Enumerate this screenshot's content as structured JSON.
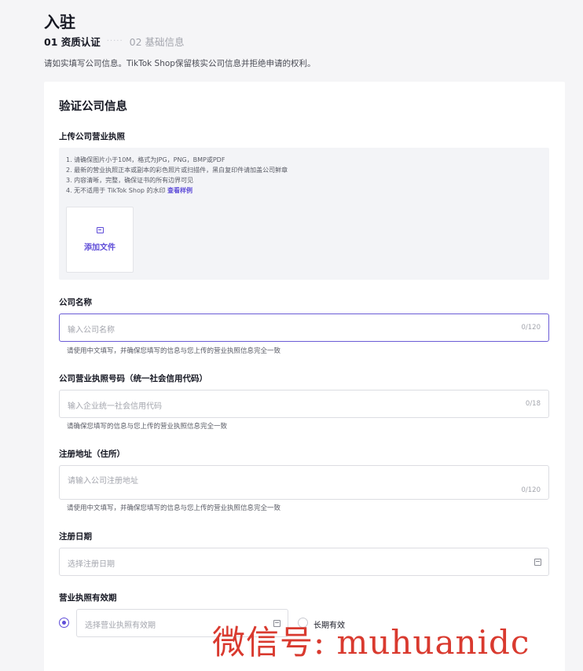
{
  "header": {
    "title": "入驻",
    "steps": [
      {
        "label": "01 资质认证"
      },
      {
        "label": "02 基础信息"
      }
    ],
    "step_separator": "·····",
    "intro": "请如实填写公司信息。TikTok Shop保留核实公司信息并拒绝申请的权利。"
  },
  "card": {
    "title": "验证公司信息",
    "license_upload": {
      "label": "上传公司营业执照",
      "rules": [
        "1. 请确保图片小于10M，格式为JPG，PNG，BMP或PDF",
        "2. 最新的营业执照正本或副本的彩色照片或扫描件，黑白复印件请加盖公司鲜章",
        "3. 内容清晰，完整，确保证书的所有边界可见",
        "4. 无不适用于 TikTok Shop 的水印"
      ],
      "rules_link": "查看样例",
      "add_file_label": "添加文件",
      "icon": "image-icon"
    },
    "company_name": {
      "label": "公司名称",
      "placeholder": "输入公司名称",
      "counter": "0/120",
      "helper": "请使用中文填写，并确保您填写的信息与您上传的营业执照信息完全一致"
    },
    "credit_code": {
      "label": "公司营业执照号码（统一社会信用代码）",
      "placeholder": "输入企业统一社会信用代码",
      "counter": "0/18",
      "helper": "请确保您填写的信息与您上传的营业执照信息完全一致"
    },
    "address": {
      "label": "注册地址（住所）",
      "placeholder": "请输入公司注册地址",
      "counter": "0/120",
      "helper": "请使用中文填写，并确保您填写的信息与您上传的营业执照信息完全一致"
    },
    "reg_date": {
      "label": "注册日期",
      "placeholder": "选择注册日期",
      "icon": "calendar-icon"
    },
    "validity": {
      "label": "营业执照有效期",
      "placeholder": "选择营业执照有效期",
      "long_term_label": "长期有效",
      "icon": "calendar-icon"
    }
  },
  "watermark": "微信号: muhuanidc",
  "colors": {
    "accent": "#5f4dd8",
    "watermark": "#d93a2f"
  }
}
